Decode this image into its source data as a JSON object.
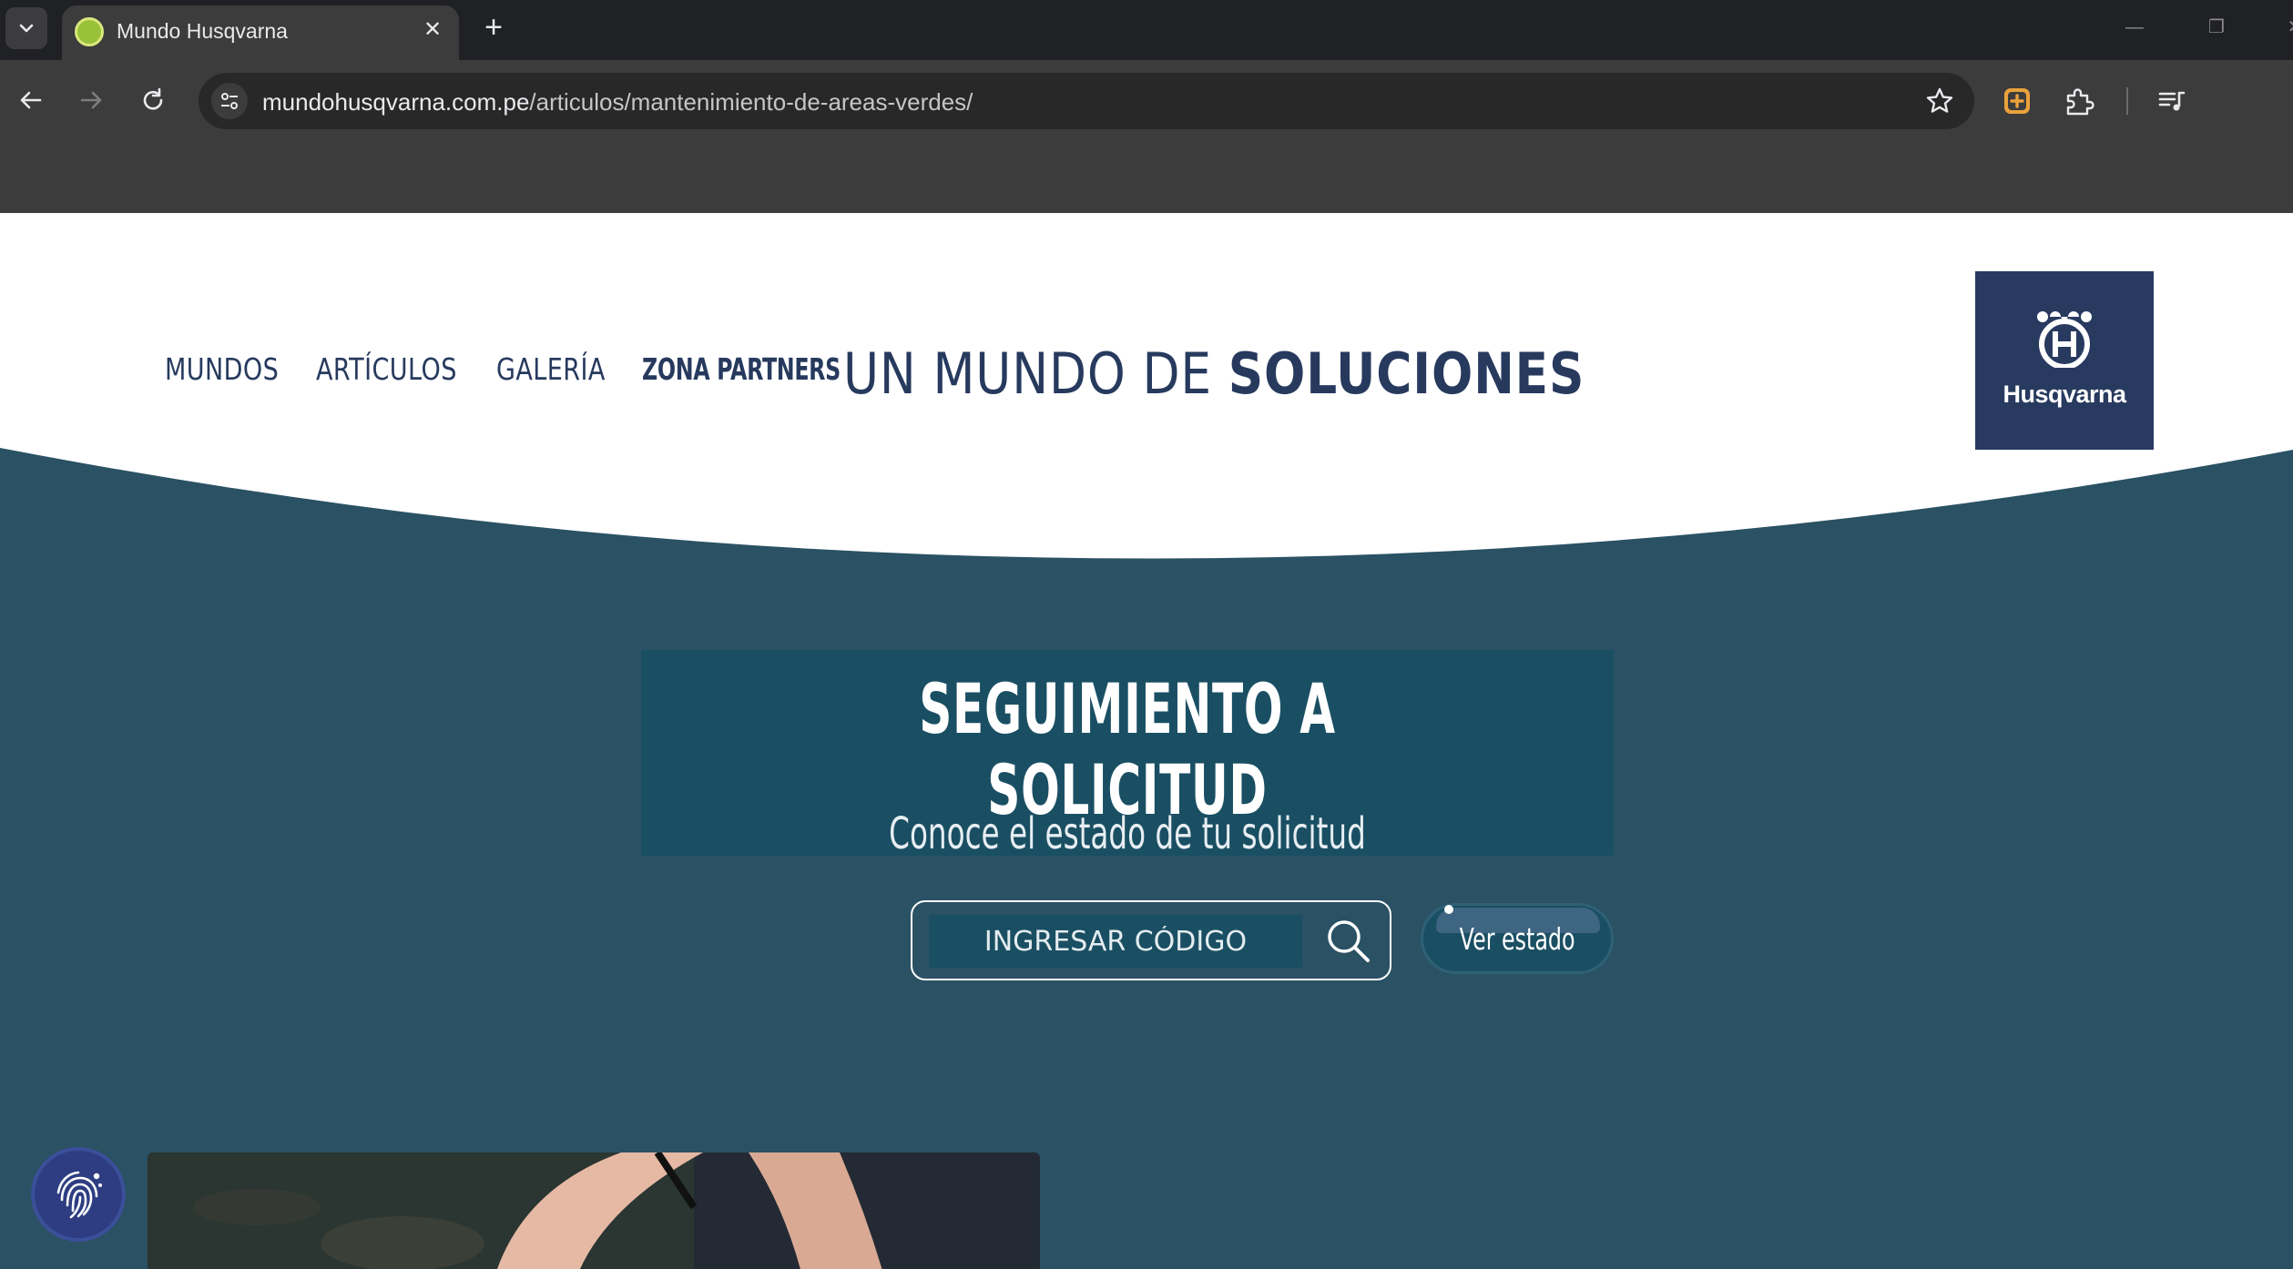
{
  "browser": {
    "tab_title": "Mundo Husqvarna",
    "tab_close_glyph": "✕",
    "new_tab_glyph": "+",
    "url_domain": "mundohusqvarna.com.pe",
    "url_path": "/articulos/mantenimiento-de-areas-verdes/",
    "window_minimize_glyph": "—",
    "window_restore_glyph": "❐",
    "window_close_glyph": "✕"
  },
  "site": {
    "nav": {
      "mundos": "MUNDOS",
      "articulos": "ARTÍCULOS",
      "galeria": "GALERÍA",
      "partners": "ZONA PARTNERS"
    },
    "tagline_light": "UN MUNDO DE ",
    "tagline_bold": "SOLUCIONES",
    "logo_text": "Husqvarna",
    "tracking": {
      "title": "SEGUIMIENTO A SOLICITUD",
      "subtitle": "Conoce el estado de tu solicitud",
      "code_placeholder": "INGRESAR CÓDIGO",
      "status_button": "Ver estado"
    }
  },
  "colors": {
    "page_bg": "#2a5164",
    "panel_bg": "#1a4f63",
    "brand_navy": "#283a5f",
    "nav_text": "#273a5e",
    "chrome_dark": "#202124",
    "chrome_toolbar": "#3c3c3c"
  }
}
